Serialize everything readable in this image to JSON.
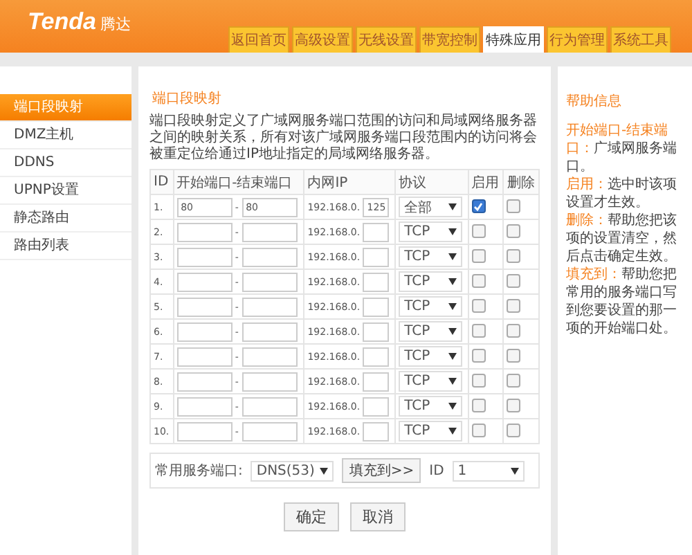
{
  "logo": {
    "brand": "Tenda",
    "cn": "腾达"
  },
  "tabs": [
    {
      "label": "返回首页",
      "selected": false
    },
    {
      "label": "高级设置",
      "selected": false
    },
    {
      "label": "无线设置",
      "selected": false
    },
    {
      "label": "带宽控制",
      "selected": false
    },
    {
      "label": "特殊应用",
      "selected": true
    },
    {
      "label": "行为管理",
      "selected": false
    },
    {
      "label": "系统工具",
      "selected": false
    }
  ],
  "sidebar": {
    "items": [
      {
        "label": "端口段映射",
        "selected": true
      },
      {
        "label": "DMZ主机",
        "selected": false
      },
      {
        "label": "DDNS",
        "selected": false
      },
      {
        "label": "UPNP设置",
        "selected": false
      },
      {
        "label": "静态路由",
        "selected": false
      },
      {
        "label": "路由列表",
        "selected": false
      }
    ]
  },
  "main": {
    "title": "端口段映射",
    "description": "端口段映射定义了广域网服务端口范围的访问和局域网络服务器之间的映射关系，所有对该广域网服务端口段范围内的访问将会被重定位给通过IP地址指定的局域网络服务器。",
    "table": {
      "columns": [
        "ID",
        "开始端口-结束端口",
        "内网IP",
        "协议",
        "启用",
        "删除"
      ],
      "rows": [
        {
          "id": "1.",
          "start": "80",
          "dash": "-",
          "end": "80",
          "ip_prefix": "192.168.0.",
          "ip": "125",
          "protocol": "全部",
          "enabled": true,
          "delete": false
        },
        {
          "id": "2.",
          "dash": "-",
          "ip_prefix": "192.168.0.",
          "protocol": "TCP",
          "enabled": false,
          "delete": false
        },
        {
          "id": "3.",
          "dash": "-",
          "ip_prefix": "192.168.0.",
          "protocol": "TCP",
          "enabled": false,
          "delete": false
        },
        {
          "id": "4.",
          "dash": "-",
          "ip_prefix": "192.168.0.",
          "protocol": "TCP",
          "enabled": false,
          "delete": false
        },
        {
          "id": "5.",
          "dash": "-",
          "ip_prefix": "192.168.0.",
          "protocol": "TCP",
          "enabled": false,
          "delete": false
        },
        {
          "id": "6.",
          "dash": "-",
          "ip_prefix": "192.168.0.",
          "protocol": "TCP",
          "enabled": false,
          "delete": false
        },
        {
          "id": "7.",
          "dash": "-",
          "ip_prefix": "192.168.0.",
          "protocol": "TCP",
          "enabled": false,
          "delete": false
        },
        {
          "id": "8.",
          "dash": "-",
          "ip_prefix": "192.168.0.",
          "protocol": "TCP",
          "enabled": false,
          "delete": false
        },
        {
          "id": "9.",
          "dash": "-",
          "ip_prefix": "192.168.0.",
          "protocol": "TCP",
          "enabled": false,
          "delete": false
        },
        {
          "id": "10.",
          "dash": "-",
          "ip_prefix": "192.168.0.",
          "protocol": "TCP",
          "enabled": false,
          "delete": false
        }
      ]
    },
    "common_service": {
      "label": "常用服务端口:",
      "service": "DNS(53)",
      "fill_button": "填充到>>",
      "id_label": "ID",
      "id_value": "1"
    },
    "buttons": [
      "确定",
      "取消"
    ]
  },
  "help": {
    "title": "帮助信息",
    "items": [
      {
        "term": "开始端口-结束端口：",
        "text": "广域网服务端口。"
      },
      {
        "term": "启用：",
        "text": "选中时该项设置才生效。"
      },
      {
        "term": "删除：",
        "text": "帮助您把该项的设置清空，然后点击确定生效。"
      },
      {
        "term": "填充到：",
        "text": "帮助您把常用的服务端口写到您要设置的那一项的开始端口处。"
      }
    ]
  }
}
